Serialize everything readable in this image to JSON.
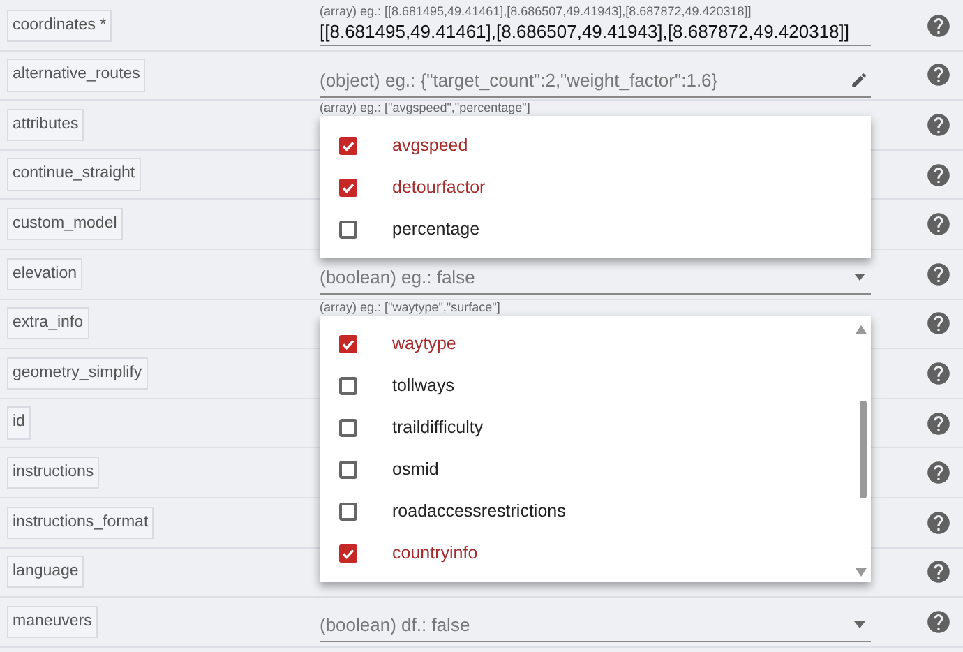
{
  "rows": [
    {
      "label": "coordinates *",
      "field": {
        "kind": "text",
        "hint": "(array) eg.: [[8.681495,49.41461],[8.686507,49.41943],[8.687872,49.420318]]",
        "value": "[[8.681495,49.41461],[8.686507,49.41943],[8.687872,49.420318]]"
      }
    },
    {
      "label": "alternative_routes",
      "field": {
        "kind": "object",
        "placeholder": "(object) eg.: {\"target_count\":2,\"weight_factor\":1.6}"
      }
    },
    {
      "label": "attributes",
      "field": {
        "kind": "multiselect",
        "hint": "(array) eg.: [\"avgspeed\",\"percentage\"]",
        "scrollable": false,
        "options": [
          {
            "label": "avgspeed",
            "checked": true
          },
          {
            "label": "detourfactor",
            "checked": true
          },
          {
            "label": "percentage",
            "checked": false
          }
        ]
      }
    },
    {
      "label": "continue_straight"
    },
    {
      "label": "custom_model"
    },
    {
      "label": "elevation",
      "field": {
        "kind": "select",
        "placeholder": "(boolean) eg.: false"
      }
    },
    {
      "label": "extra_info",
      "field": {
        "kind": "multiselect",
        "hint": "(array) eg.: [\"waytype\",\"surface\"]",
        "scrollable": true,
        "options": [
          {
            "label": "waytype",
            "checked": true
          },
          {
            "label": "tollways",
            "checked": false
          },
          {
            "label": "traildifficulty",
            "checked": false
          },
          {
            "label": "osmid",
            "checked": false
          },
          {
            "label": "roadaccessrestrictions",
            "checked": false
          },
          {
            "label": "countryinfo",
            "checked": true
          }
        ]
      }
    },
    {
      "label": "geometry_simplify"
    },
    {
      "label": "id"
    },
    {
      "label": "instructions"
    },
    {
      "label": "instructions_format"
    },
    {
      "label": "language"
    },
    {
      "label": "maneuvers",
      "field": {
        "kind": "select",
        "placeholder": "(boolean) df.: false"
      }
    }
  ]
}
